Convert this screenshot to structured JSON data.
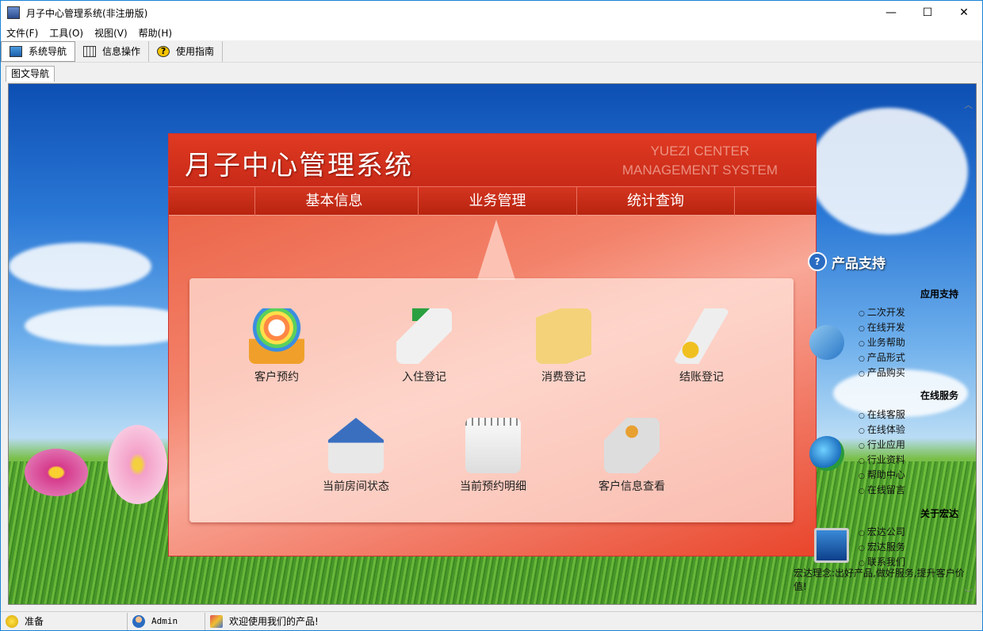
{
  "window": {
    "title": "月子中心管理系统(非注册版)",
    "minimize": "—",
    "maximize": "☐",
    "close": "✕"
  },
  "menu": [
    "文件(F)",
    "工具(O)",
    "视图(V)",
    "帮助(H)"
  ],
  "toolbar": {
    "nav_label": "系统导航",
    "info_label": "信息操作",
    "guide_label": "使用指南"
  },
  "tab": {
    "label": "图文导航"
  },
  "panel": {
    "title": "月子中心管理系统",
    "subtitle_line1": "YUEZI CENTER",
    "subtitle_line2": "MANAGEMENT SYSTEM",
    "nav": [
      "基本信息",
      "业务管理",
      "统计查询"
    ]
  },
  "functions": [
    {
      "label": "客户预约",
      "icon": "rainbow-people-icon"
    },
    {
      "label": "入住登记",
      "icon": "register-pen-icon"
    },
    {
      "label": "消费登记",
      "icon": "clipboard-icon"
    },
    {
      "label": "结账登记",
      "icon": "coins-icon"
    },
    {
      "label": "当前房间状态",
      "icon": "house-icon"
    },
    {
      "label": "当前预约明细",
      "icon": "notebook-icon"
    },
    {
      "label": "客户信息查看",
      "icon": "person-info-icon"
    }
  ],
  "support": {
    "title": "产品支持",
    "app_support": {
      "head": "应用支持",
      "items": [
        "二次开发",
        "在线开发",
        "业务帮助",
        "产品形式",
        "产品购买"
      ]
    },
    "online_service": {
      "head": "在线服务",
      "items": [
        "在线客服",
        "在线体验",
        "行业应用",
        "行业资料",
        "帮助中心",
        "在线留言"
      ]
    },
    "about": {
      "head": "关于宏达",
      "items": [
        "宏达公司",
        "宏达服务",
        "联系我们"
      ]
    },
    "slogan": "宏达理念:出好产品,做好服务,提升客户价值!"
  },
  "status": {
    "ready": "准备",
    "user": "Admin",
    "welcome": "欢迎使用我们的产品!"
  },
  "colors": {
    "accent": "#d8341f",
    "title_bar": "#ffffff",
    "frame": "#1883d7"
  }
}
